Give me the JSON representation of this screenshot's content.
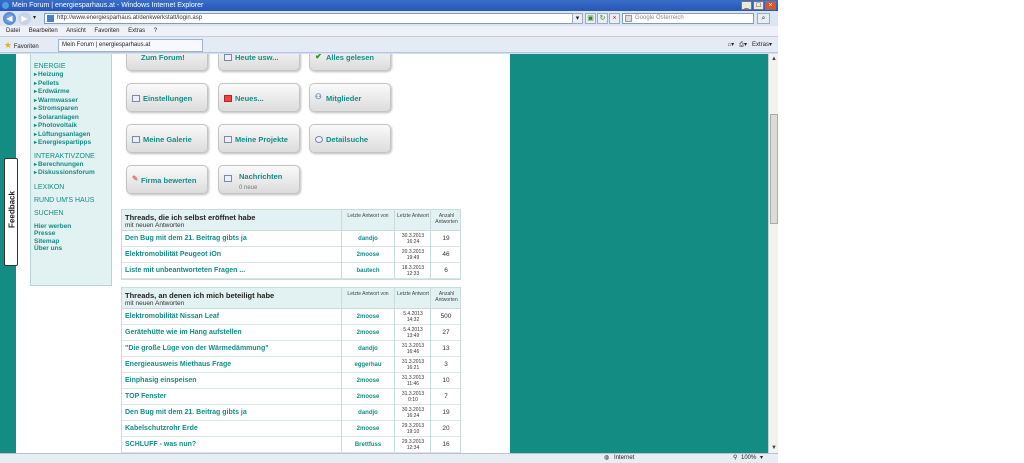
{
  "window": {
    "title": "Mein Forum | energiesparhaus.at - Windows Internet Explorer"
  },
  "address": {
    "url": "http://www.energiesparhaus.at/denkwerkstatt/login.asp",
    "search_placeholder": "Google Österreich"
  },
  "menu": [
    "Datei",
    "Bearbeiten",
    "Ansicht",
    "Favoriten",
    "Extras",
    "?"
  ],
  "favbar": {
    "favorites_label": "Favoriten",
    "tab_label": "Mein Forum | energiesparhaus.at",
    "tools_label": "Extras"
  },
  "feedback_label": "Feedback",
  "sidebar": {
    "energie_heading": "ENERGIE",
    "energie_items": [
      "Heizung",
      "Pellets",
      "Erdwärme",
      "Warmwasser",
      "Stromsparen",
      "Solaranlagen",
      "Photovoltaik",
      "Lüftungsanlagen",
      "Energiespartipps"
    ],
    "interaktiv_heading": "INTERAKTIVZONE",
    "interaktiv_items": [
      "Berechnungen",
      "Diskussionsforum"
    ],
    "lexikon": "LEXIKON",
    "rund": "RUND UM'S HAUS",
    "suchen": "SUCHEN",
    "footer_links": [
      "Hier werben",
      "Presse",
      "Sitemap",
      "Über uns"
    ]
  },
  "buttons": {
    "zum_forum": "Zum Forum!",
    "heute": "Heute usw...",
    "alles_gelesen": "Alles gelesen",
    "einstellungen": "Einstellungen",
    "neues": "Neues...",
    "mitglieder": "Mitglieder",
    "galerie": "Meine Galerie",
    "projekte": "Meine Projekte",
    "detailsuche": "Detailsuche",
    "firma": "Firma bewerten",
    "nachrichten": "Nachrichten",
    "nachrichten_sub": "0 neue"
  },
  "columns": {
    "last_by": "Letzte Antwort von",
    "last": "Letzte Antwort",
    "count": "Anzahl Antworten"
  },
  "own_threads": {
    "title": "Threads, die ich selbst eröffnet habe",
    "subtitle": "mit neuen Antworten",
    "rows": [
      {
        "title": "Den Bug mit dem 21. Beitrag gibts ja",
        "user": "dandjo",
        "date": "30.3.2013",
        "time": "16:24",
        "count": "19"
      },
      {
        "title": "Elektromobilität Peugeot iOn",
        "user": "2moose",
        "date": "20.3.2013",
        "time": "19:49",
        "count": "46"
      },
      {
        "title": "Liste mit unbeantworteten Fragen ...",
        "user": "bautech",
        "date": "18.3.2013",
        "time": "12:33",
        "count": "6"
      }
    ]
  },
  "joined_threads": {
    "title": "Threads, an denen ich mich beteiligt habe",
    "subtitle": "mit neuen Antworten",
    "rows": [
      {
        "title": "Elektromobilität Nissan Leaf",
        "user": "2moose",
        "date": "5.4.2013",
        "time": "14:32",
        "count": "500"
      },
      {
        "title": "Gerätehütte wie im Hang aufstellen",
        "user": "2moose",
        "date": "5.4.2013",
        "time": "13:49",
        "count": "27"
      },
      {
        "title": "\"Die große Lüge von der Wärmedämmung\"",
        "user": "dandjo",
        "date": "31.3.2013",
        "time": "16:46",
        "count": "13"
      },
      {
        "title": "Energieausweis Miethaus Frage",
        "user": "eggerhau",
        "date": "31.3.2013",
        "time": "16:21",
        "count": "3"
      },
      {
        "title": "Einphasig einspeisen",
        "user": "2moose",
        "date": "31.3.2013",
        "time": "11:46",
        "count": "10"
      },
      {
        "title": "TOP Fenster",
        "user": "2moose",
        "date": "31.3.2013",
        "time": "0:10",
        "count": "7"
      },
      {
        "title": "Den Bug mit dem 21. Beitrag gibts ja",
        "user": "dandjo",
        "date": "30.3.2013",
        "time": "16:24",
        "count": "19"
      },
      {
        "title": "Kabelschutzrohr Erde",
        "user": "2moose",
        "date": "29.3.2013",
        "time": "19:10",
        "count": "20"
      },
      {
        "title": "SCHLUFF - was nun?",
        "user": "Brettfuss",
        "date": "29.3.2013",
        "time": "12:34",
        "count": "16"
      }
    ]
  },
  "status": {
    "zone": "Internet",
    "zoom": "100%"
  }
}
